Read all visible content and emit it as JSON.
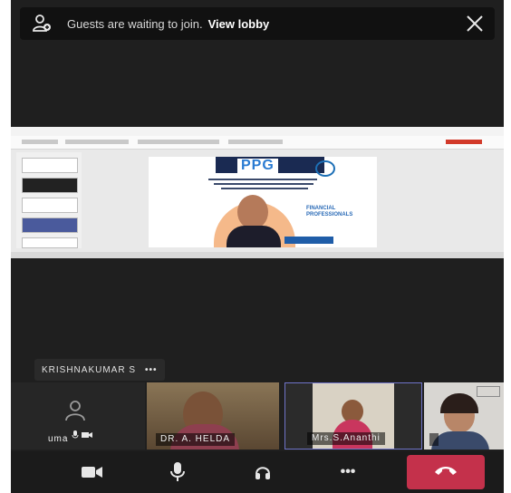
{
  "lobby_banner": {
    "message": "Guests are waiting to join.",
    "action_label": "View lobby",
    "icons": [
      "people-icon",
      "close-icon"
    ]
  },
  "shared_screen": {
    "slide_logo_text": "PPG",
    "slide_side_text": "FINANCIAL PROFESSIONALS"
  },
  "presenter": {
    "name": "KRISHNAKUMAR S",
    "more_label": "•••"
  },
  "participants": [
    {
      "name": "uma",
      "icons": [
        "person-icon",
        "mic-icon",
        "camera-icon"
      ]
    },
    {
      "name": "DR. A. HELDA"
    },
    {
      "name": "Mrs.S.Ananthi"
    },
    {
      "name": ""
    }
  ],
  "controls": {
    "more_label": "•••",
    "icons": [
      "camera-icon",
      "microphone-icon",
      "speaker-icon",
      "more-icon",
      "hang-up-icon"
    ],
    "hangup_color": "#c4314b"
  },
  "colors": {
    "background": "#1f1f1f",
    "banner": "#111111",
    "active_speaker_border": "#6f74c9",
    "slide_header": "#1a2a52"
  }
}
